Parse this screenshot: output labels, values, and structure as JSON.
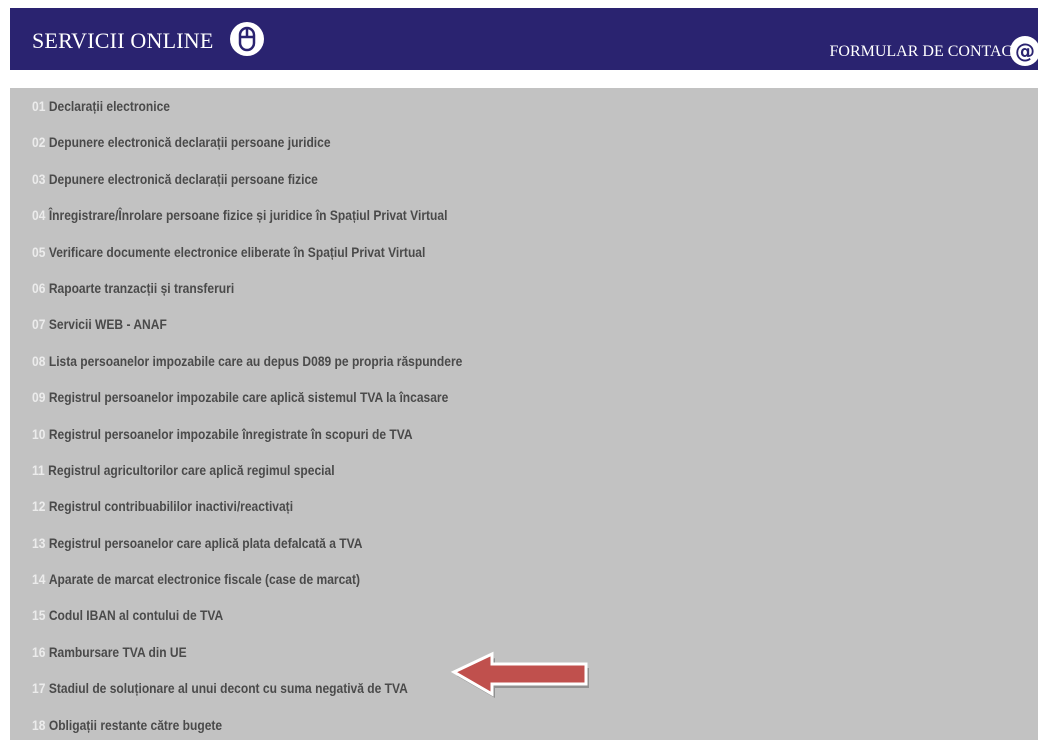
{
  "header": {
    "title": "SERVICII ONLINE",
    "contact_label": "FORMULAR DE CONTACT",
    "icons": {
      "mouse": "mouse-icon",
      "contact": "at-icon"
    },
    "colors": {
      "bar": "#2a2370",
      "panel": "#c2c2c2",
      "arrow": "#c0504d"
    }
  },
  "services": [
    {
      "num": "01",
      "label": "Declarații electronice"
    },
    {
      "num": "02",
      "label": "Depunere electronică declarații persoane juridice"
    },
    {
      "num": "03",
      "label": "Depunere electronică declarații persoane fizice"
    },
    {
      "num": "04",
      "label": "Înregistrare/Înrolare persoane fizice și juridice în Spațiul Privat Virtual"
    },
    {
      "num": "05",
      "label": "Verificare documente electronice eliberate în Spațiul Privat Virtual"
    },
    {
      "num": "06",
      "label": "Rapoarte tranzacții și transferuri"
    },
    {
      "num": "07",
      "label": "Servicii WEB - ANAF"
    },
    {
      "num": "08",
      "label": "Lista persoanelor impozabile care au depus D089 pe propria răspundere"
    },
    {
      "num": "09",
      "label": "Registrul persoanelor impozabile care aplică sistemul TVA la încasare"
    },
    {
      "num": "10",
      "label": "Registrul persoanelor impozabile înregistrate în scopuri de TVA"
    },
    {
      "num": "11",
      "label": "Registrul agricultorilor care aplică regimul special"
    },
    {
      "num": "12",
      "label": "Registrul contribuabililor inactivi/reactivați"
    },
    {
      "num": "13",
      "label": "Registrul persoanelor care aplică plata defalcată a TVA"
    },
    {
      "num": "14",
      "label": "Aparate de marcat electronice fiscale (case de marcat)"
    },
    {
      "num": "15",
      "label": "Codul IBAN al contului de TVA"
    },
    {
      "num": "16",
      "label": "Rambursare TVA din UE"
    },
    {
      "num": "17",
      "label": "Stadiul de soluționare al unui decont cu suma negativă de TVA"
    },
    {
      "num": "18",
      "label": "Obligații restante către bugete"
    }
  ]
}
